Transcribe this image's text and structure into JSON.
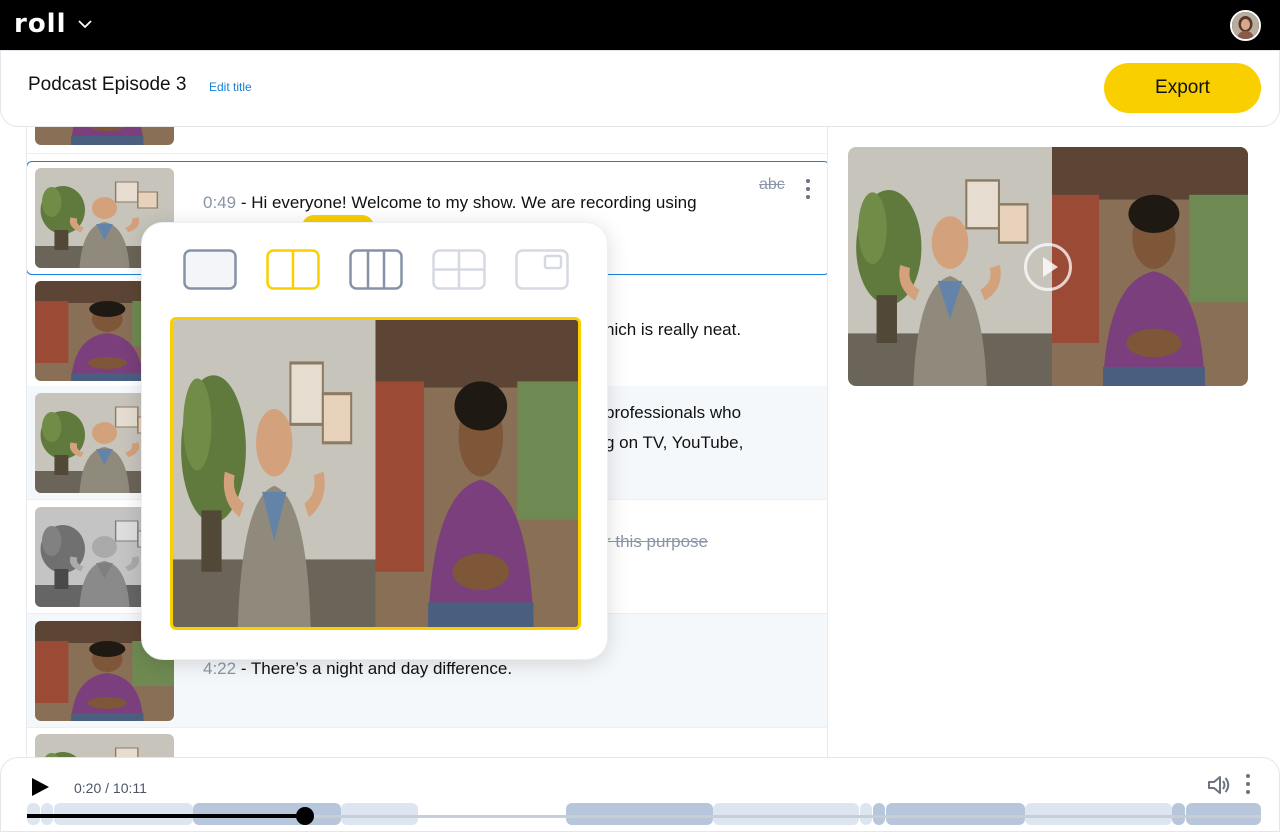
{
  "app": {
    "logo_text": "roll"
  },
  "header": {
    "title": "Podcast Episode 3",
    "edit_title_label": "Edit title",
    "export_label": "Export"
  },
  "transcript": {
    "rows": [
      {
        "timestamp": "0:49",
        "text": " - Hi everyone! Welcome to my show. We are recording using"
      },
      {
        "text": "hich is really neat."
      },
      {
        "text_line1": "professionals who",
        "text_line2": "g on TV, YouTube,"
      },
      {
        "struck_text": "r this purpose"
      },
      {
        "timestamp": "4:22",
        "text": " - There’s a night and day difference."
      }
    ],
    "deleted_words_icon": "abc"
  },
  "layout_menu": {
    "options": [
      "single-layout-icon",
      "split-two-layout-icon",
      "split-three-layout-icon",
      "grid-four-layout-icon",
      "picture-in-picture-layout-icon"
    ],
    "selected": "split-two-layout-icon"
  },
  "player": {
    "time": "0:20 / 10:11",
    "progress": 0.225
  },
  "colors": {
    "accent": "#f9cf00",
    "selection": "#1a7fd8",
    "segment_dark": "#b8c6db",
    "segment_light": "#dde5f0"
  }
}
